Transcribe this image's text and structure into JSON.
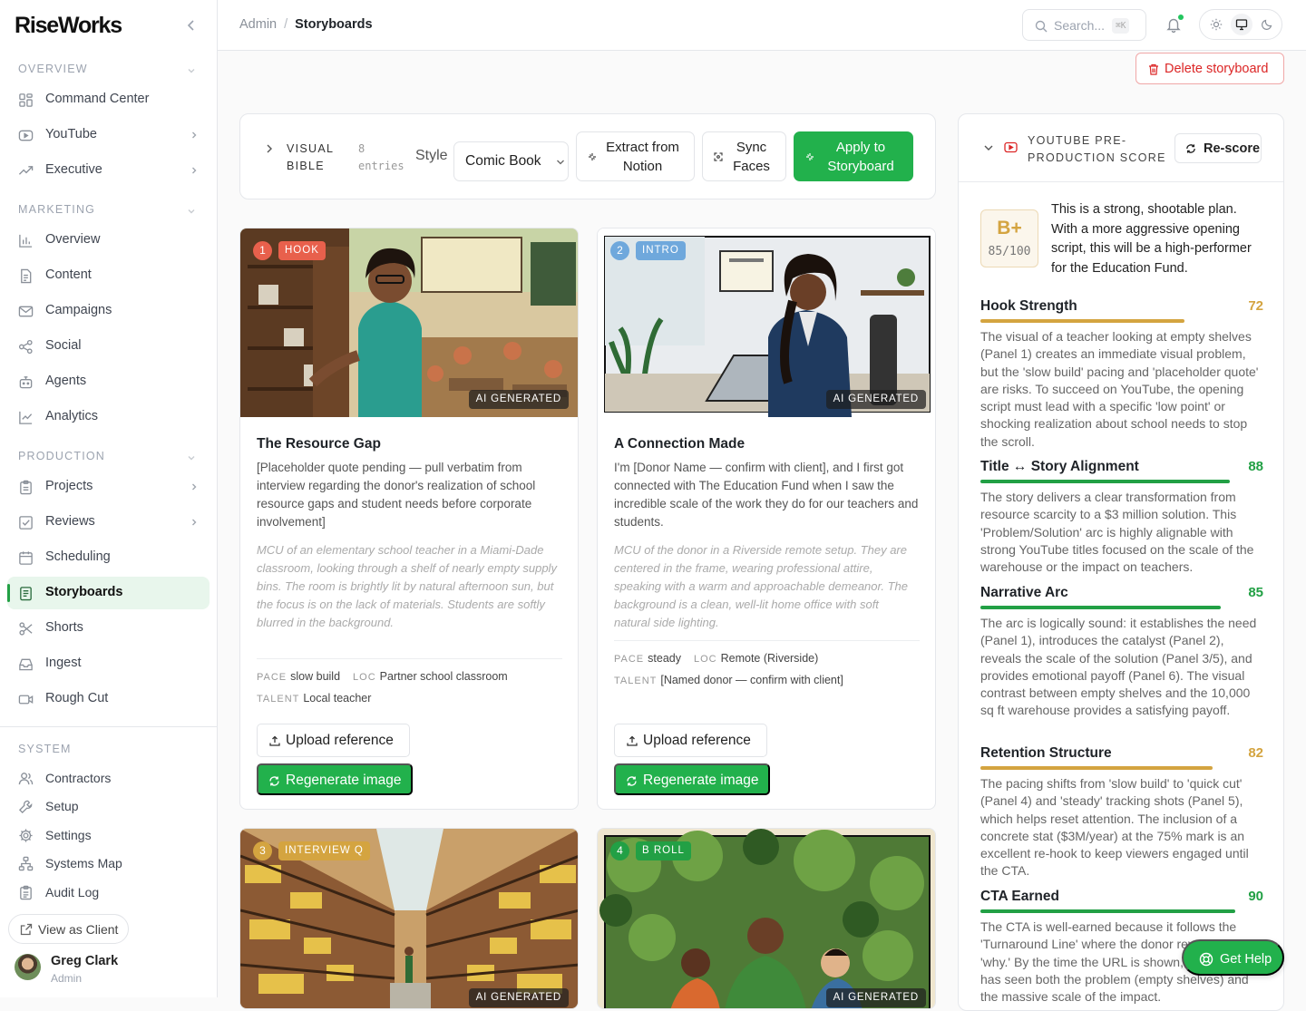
{
  "brand": "RiseWorks",
  "sidebar": {
    "sections": {
      "overview": "OVERVIEW",
      "marketing": "MARKETING",
      "production": "PRODUCTION",
      "system": "SYSTEM"
    },
    "overview_items": [
      {
        "label": "Command Center",
        "icon": "grid-icon"
      },
      {
        "label": "YouTube",
        "icon": "youtube-icon"
      },
      {
        "label": "Executive",
        "icon": "trending-icon"
      }
    ],
    "marketing_items": [
      {
        "label": "Overview",
        "icon": "bar-chart-icon"
      },
      {
        "label": "Content",
        "icon": "file-icon"
      },
      {
        "label": "Campaigns",
        "icon": "mail-icon"
      },
      {
        "label": "Social",
        "icon": "share-icon"
      },
      {
        "label": "Agents",
        "icon": "bot-icon"
      },
      {
        "label": "Analytics",
        "icon": "line-chart-icon"
      }
    ],
    "production_items": [
      {
        "label": "Projects",
        "icon": "clipboard-icon"
      },
      {
        "label": "Reviews",
        "icon": "check-square-icon"
      },
      {
        "label": "Scheduling",
        "icon": "calendar-icon"
      },
      {
        "label": "Storyboards",
        "icon": "storyboard-icon"
      },
      {
        "label": "Shorts",
        "icon": "scissors-icon"
      },
      {
        "label": "Ingest",
        "icon": "inbox-icon"
      },
      {
        "label": "Rough Cut",
        "icon": "video-icon"
      }
    ],
    "active": "Storyboards",
    "system_items": [
      {
        "label": "Contractors",
        "icon": "users-icon"
      },
      {
        "label": "Setup",
        "icon": "wrench-icon"
      },
      {
        "label": "Settings",
        "icon": "gear-icon"
      },
      {
        "label": "Systems Map",
        "icon": "network-icon"
      },
      {
        "label": "Audit Log",
        "icon": "clipboard-list-icon"
      }
    ],
    "view_as_client": "View as Client",
    "user": {
      "name": "Greg Clark",
      "role": "Admin"
    }
  },
  "topbar": {
    "breadcrumb": [
      "Admin",
      "Storyboards"
    ],
    "search_placeholder": "Search...",
    "search_shortcut": "⌘K"
  },
  "actions": {
    "delete": "Delete storyboard"
  },
  "visual_bible": {
    "title_line1": "VISUAL",
    "title_line2": "BIBLE",
    "count_line1": "8",
    "count_line2": "entries",
    "style_label": "Style",
    "style_value": "Comic Book",
    "extract_line1": "Extract from",
    "extract_line2": "Notion",
    "sync_line1": "Sync",
    "sync_line2": "Faces",
    "apply_line1": "Apply to",
    "apply_line2": "Storyboard"
  },
  "panels": [
    {
      "num": "1",
      "tag": "HOOK",
      "tag_color": "#e8604c",
      "ai_label": "AI GENERATED",
      "title": "The Resource Gap",
      "quote": "[Placeholder quote pending — pull verbatim from interview regarding the donor's realization of school resource gaps and student needs before corporate involvement]",
      "description": "MCU of an elementary school teacher in a Miami-Dade classroom, looking through a shelf of nearly empty supply bins. The room is brightly lit by natural afternoon sun, but the focus is on the lack of materials. Students are softly blurred in the background.",
      "pace_key": "PACE",
      "pace": "slow build",
      "loc_key": "LOC",
      "loc": "Partner school classroom",
      "talent_key": "TALENT",
      "talent": "Local teacher",
      "upload_label": "Upload reference",
      "regen_label": "Regenerate image"
    },
    {
      "num": "2",
      "tag": "INTRO",
      "tag_color": "#6fa8dc",
      "ai_label": "AI GENERATED",
      "title": "A Connection Made",
      "quote": "I'm [Donor Name — confirm with client], and I first got connected with The Education Fund when I saw the incredible scale of the work they do for our teachers and students.",
      "description": "MCU of the donor in a Riverside remote setup. They are centered in the frame, wearing professional attire, speaking with a warm and approachable demeanor. The background is a clean, well-lit home office with soft natural side lighting.",
      "pace_key": "PACE",
      "pace": "steady",
      "loc_key": "LOC",
      "loc": "Remote (Riverside)",
      "talent_key": "TALENT",
      "talent": "[Named donor — confirm with client]",
      "upload_label": "Upload reference",
      "regen_label": "Regenerate image"
    },
    {
      "num": "3",
      "tag": "INTERVIEW Q",
      "tag_color": "#d4a440",
      "ai_label": "AI GENERATED"
    },
    {
      "num": "4",
      "tag": "B ROLL",
      "tag_color": "#22a045",
      "ai_label": "AI GENERATED"
    }
  ],
  "score": {
    "title_line1": "YOUTUBE PRE-",
    "title_line2": "PRODUCTION SCORE",
    "rescore": "Re-score",
    "grade": "B+",
    "grade_score": "85/100",
    "summary": "This is a strong, shootable plan. With a more aggressive opening script, this will be a high-performer for the Education Fund.",
    "metrics": [
      {
        "name": "Hook Strength",
        "value": "72",
        "fraction": 0.72,
        "color": "#d4a440",
        "text": "The visual of a teacher looking at empty shelves (Panel 1) creates an immediate visual problem, but the 'slow build' pacing and 'placeholder quote' are risks. To succeed on YouTube, the opening script must lead with a specific 'low point' or shocking realization about school needs to stop the scroll."
      },
      {
        "name": "Title ↔ Story Alignment",
        "value": "88",
        "fraction": 0.88,
        "color": "#22a045",
        "text": "The story delivers a clear transformation from resource scarcity to a $3 million solution. This 'Problem/Solution' arc is highly alignable with strong YouTube titles focused on the scale of the warehouse or the impact on teachers."
      },
      {
        "name": "Narrative Arc",
        "value": "85",
        "fraction": 0.85,
        "color": "#22a045",
        "text": "The arc is logically sound: it establishes the need (Panel 1), introduces the catalyst (Panel 2), reveals the scale of the solution (Panel 3/5), and provides emotional payoff (Panel 6). The visual contrast between empty shelves and the 10,000 sq ft warehouse provides a satisfying payoff."
      },
      {
        "name": "Retention Structure",
        "value": "82",
        "fraction": 0.82,
        "color": "#d4a440",
        "text": "The pacing shifts from 'slow build' to 'quick cut' (Panel 4) and 'steady' tracking shots (Panel 5), which helps reset attention. The inclusion of a concrete stat ($3M/year) at the 75% mark is an excellent re-hook to keep viewers engaged until the CTA."
      },
      {
        "name": "CTA Earned",
        "value": "90",
        "fraction": 0.9,
        "color": "#22a045",
        "text": "The CTA is well-earned because it follows the 'Turnaround Line' where the donor reveals their 'why.' By the time the URL is shown, the viewer has seen both the problem (empty shelves) and the massive scale of the impact."
      }
    ]
  },
  "help": "Get Help"
}
